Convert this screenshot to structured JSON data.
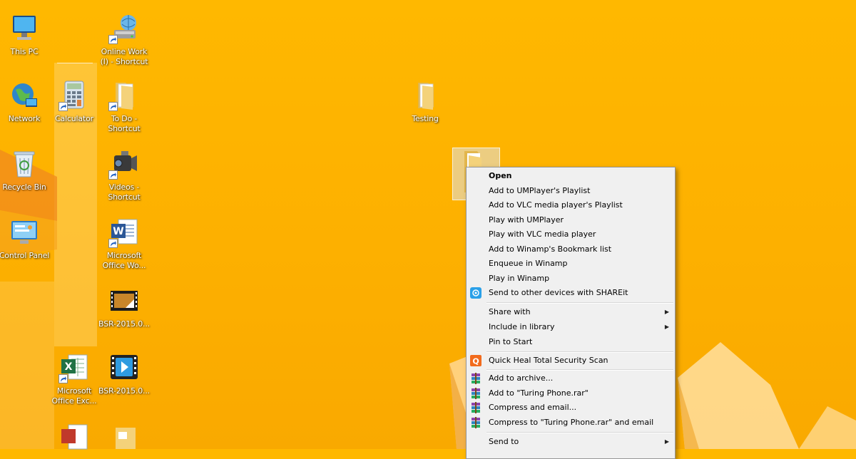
{
  "desktop": {
    "icons": [
      {
        "label": "This PC"
      },
      {
        "label": "Online Work (I) - Shortcut"
      },
      {
        "label": "Network"
      },
      {
        "label": "Calculator"
      },
      {
        "label": "To Do - Shortcut"
      },
      {
        "label": "Testing"
      },
      {
        "label": "Recycle Bin"
      },
      {
        "label": "Videos - Shortcut"
      },
      {
        "label": "Control Panel"
      },
      {
        "label": "Microsoft Office Wo..."
      },
      {
        "label": "BSR-2015.0..."
      },
      {
        "label": "Microsoft Office Exc..."
      },
      {
        "label": "BSR-2015.0..."
      }
    ]
  },
  "context_menu": {
    "items": [
      {
        "label": "Open"
      },
      {
        "label": "Add to UMPlayer's Playlist"
      },
      {
        "label": "Add to VLC media player's Playlist"
      },
      {
        "label": "Play with UMPlayer"
      },
      {
        "label": "Play with VLC media player"
      },
      {
        "label": "Add to Winamp's Bookmark list"
      },
      {
        "label": "Enqueue in Winamp"
      },
      {
        "label": "Play in Winamp"
      },
      {
        "label": "Send to other devices with SHAREit",
        "icon": "shareit-icon"
      },
      {
        "label": "Share with",
        "submenu": true
      },
      {
        "label": "Include in library",
        "submenu": true
      },
      {
        "label": "Pin to Start"
      },
      {
        "label": "Quick Heal Total Security Scan",
        "icon": "quickheal-icon"
      },
      {
        "label": "Add to archive...",
        "icon": "winrar-icon"
      },
      {
        "label": "Add to \"Turing Phone.rar\"",
        "icon": "winrar-icon"
      },
      {
        "label": "Compress and email...",
        "icon": "winrar-icon"
      },
      {
        "label": "Compress to \"Turing Phone.rar\" and email",
        "icon": "winrar-icon"
      },
      {
        "label": "Send to",
        "submenu": true
      }
    ]
  },
  "colors": {
    "desktop_bg": "#FFB800",
    "menu_bg": "#F0F0F0",
    "menu_border": "#979797"
  }
}
